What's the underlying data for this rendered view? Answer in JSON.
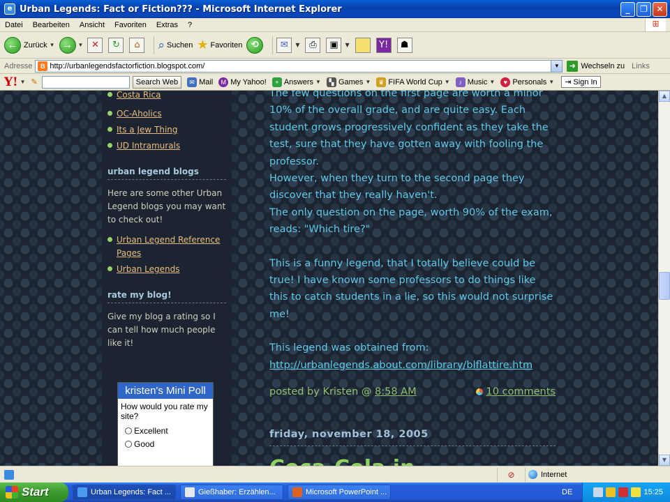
{
  "window": {
    "title": "Urban Legends: Fact or Fiction??? - Microsoft Internet Explorer"
  },
  "menu": [
    "Datei",
    "Bearbeiten",
    "Ansicht",
    "Favoriten",
    "Extras",
    "?"
  ],
  "toolbar": {
    "back": "Zurück",
    "search": "Suchen",
    "favorites": "Favoriten"
  },
  "address": {
    "label": "Adresse",
    "url": "http://urbanlegendsfactorfiction.blogspot.com/",
    "go": "Wechseln zu",
    "links": "Links"
  },
  "yahoo": {
    "logo": "Y!",
    "search_btn": "Search Web",
    "items": [
      "Mail",
      "My Yahoo!",
      "Answers",
      "Games",
      "FIFA World Cup",
      "Music",
      "Personals"
    ],
    "signin": "Sign In"
  },
  "sidebar": {
    "top_links": [
      "Costa Rica",
      "OC-Aholics",
      "Its a Jew Thing",
      "UD Intramurals"
    ],
    "blogs_heading": "urban legend blogs",
    "blogs_text": "Here are some other Urban Legend blogs you may want to check out!",
    "blog_links": [
      "Urban Legend Reference Pages",
      "Urban Legends"
    ],
    "rate_heading": "rate my blog!",
    "rate_text": "Give my blog a rating so I can tell how much people like it!",
    "poll": {
      "title": "kristen's Mini Poll",
      "question": "How would you rate my site?",
      "options": [
        "Excellent",
        "Good"
      ]
    }
  },
  "post": {
    "p1": "The few questions on the first page are worth a minor 10% of the overall grade, and are quite easy. Each student grows progressively confident as they take the test, sure that they have gotten away with fooling the professor.",
    "p2": "However, when they turn to the second page they discover that they really haven't.",
    "p3": "The only question on the page, worth 90% of the exam, reads: \"Which tire?\"",
    "p4": "This is a funny legend, that I totally believe could be true! I have known some professors to do things like this to catch students in a lie, so this would not surprise me!",
    "source_label": "This legend was obtained from:",
    "source_url": "http://urbanlegends.about.com/library/blflattire.htm",
    "posted_by": "posted by Kristen @",
    "time": "8:58 AM",
    "comments": "10 comments",
    "date_header": "friday, november 18, 2005",
    "next_title": "Coca-Cola in..."
  },
  "status": {
    "zone": "Internet"
  },
  "taskbar": {
    "start": "Start",
    "tasks": [
      "Urban Legends: Fact ...",
      "Gießhaber: Erzählen...",
      "Microsoft PowerPoint ..."
    ],
    "lang": "DE",
    "clock": "15:25"
  },
  "colors": {
    "page_bg": "#1b2430",
    "post_text": "#5fc8e6",
    "sidebar_link": "#e8bc80",
    "footer_green": "#90c070"
  }
}
